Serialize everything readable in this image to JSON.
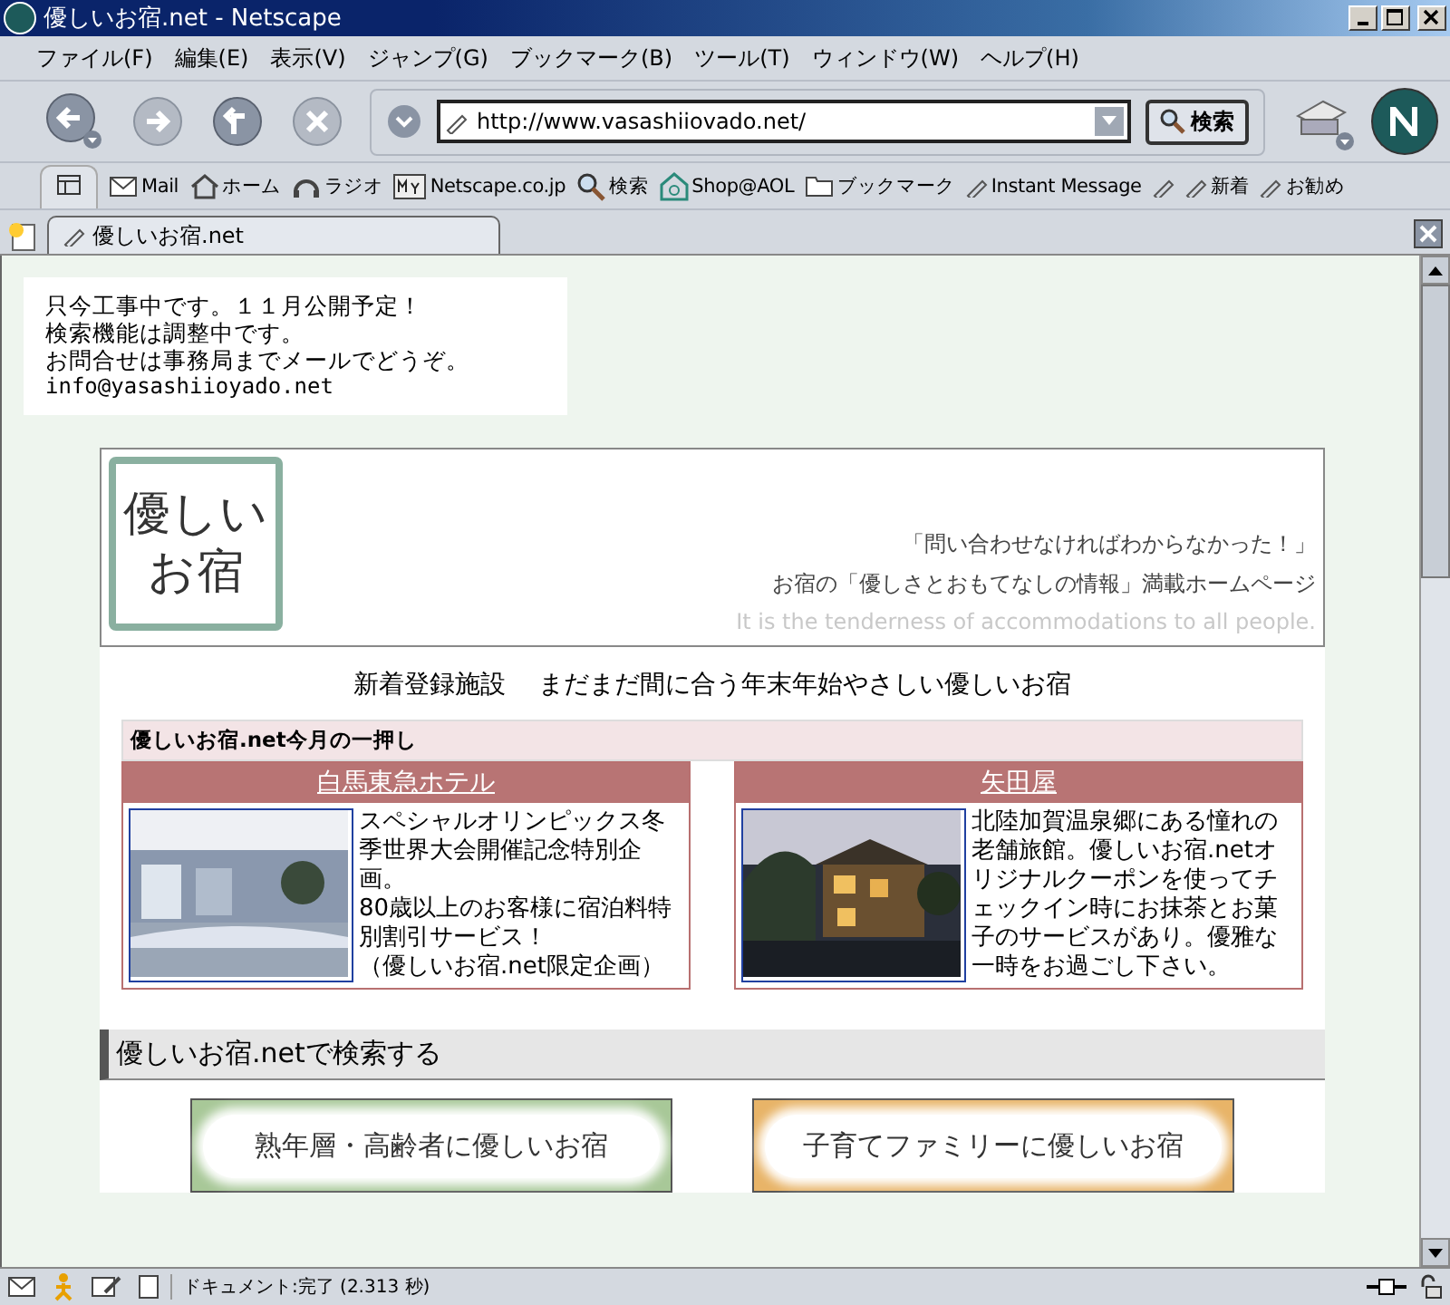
{
  "window": {
    "title": "優しいお宿.net - Netscape"
  },
  "menu": [
    "ファイル(F)",
    "編集(E)",
    "表示(V)",
    "ジャンプ(G)",
    "ブックマーク(B)",
    "ツール(T)",
    "ウィンドウ(W)",
    "ヘルプ(H)"
  ],
  "address": {
    "value": "http://www.vasashiiovado.net/"
  },
  "search_button": "検索",
  "personal_toolbar": [
    {
      "kind": "mail",
      "label": "Mail"
    },
    {
      "kind": "home",
      "label": "ホーム"
    },
    {
      "kind": "radio",
      "label": "ラジオ"
    },
    {
      "kind": "my",
      "label": "Netscape.co.jp"
    },
    {
      "kind": "search",
      "label": "検索"
    },
    {
      "kind": "shop",
      "label": "Shop@AOL"
    },
    {
      "kind": "folder",
      "label": "ブックマーク"
    },
    {
      "kind": "bookmark",
      "label": "Instant Message"
    },
    {
      "kind": "bookmark"
    },
    {
      "kind": "bookmark",
      "label": "新着"
    },
    {
      "kind": "bookmark",
      "label": "お勧め"
    }
  ],
  "tab": {
    "title": "優しいお宿.net",
    "selected": true
  },
  "notice": [
    "只今工事中です。１１月公開予定！",
    "検索機能は調整中です。",
    "お問合せは事務局までメールでどうぞ。",
    "info@yasashiioyado.net"
  ],
  "header": {
    "logo": [
      "優しい",
      "お宿"
    ],
    "tagline_1": "「問い合わせなければわからなかった！」",
    "tagline_2": "お宿の「優しさとおもてなしの情報」満載ホームページ",
    "tagline_en": "It is the tenderness of accommodations to all people."
  },
  "new_listing": "新着登録施設　 まだまだ間に合う年末年始やさしい優しいお宿",
  "featured": {
    "heading": "優しいお宿.net今月の一押し",
    "items": [
      {
        "name": "白馬東急ホテル",
        "kind": "lobby",
        "lines": [
          "スペシャルオリンピックス冬季世界大会開催記念特別企画。",
          "80歳以上のお客様に宿泊料特別割引サービス！",
          "（優しいお宿.net限定企画）"
        ]
      },
      {
        "name": "矢田屋",
        "kind": "inn",
        "lines": [
          "北陸加賀温泉郷にある憧れの老舗旅館。優しいお宿.netオリジナルクーポンを使ってチェックイン時にお抹茶とお菓子のサービスがあり。優雅な一時をお過ごし下さい。"
        ]
      }
    ]
  },
  "search_section": {
    "heading": "優しいお宿.netで検索する",
    "buttons": [
      {
        "label": "熟年層・高齢者に優しいお宿",
        "color": "#a8c898"
      },
      {
        "label": "子育てファミリーに優しいお宿",
        "color": "#e8b468"
      }
    ]
  },
  "status_bar": {
    "text": "ドキュメント:完了 (2.313 秒)"
  }
}
